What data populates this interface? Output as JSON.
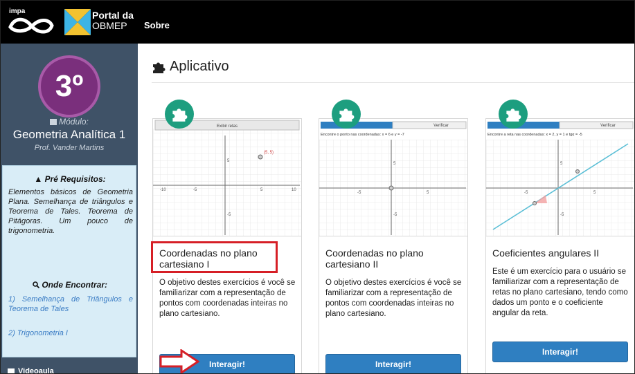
{
  "header": {
    "impa_label": "impa",
    "portal_line1": "Portal da",
    "portal_line2": "OBMEP",
    "nav_sobre": "Sobre"
  },
  "sidebar": {
    "module_number": "3º",
    "modulo_label": "Módulo:",
    "modulo_title": "Geometria Analítica 1",
    "professor": "Prof. Vander Martins",
    "prereq_title": "Pré Requisitos:",
    "prereq_text": "Elementos básicos de Geometria Plana. Semelhança de triângulos e Teorema de Tales. Teorema de Pitágoras. Um pouco de trigonometria.",
    "where_title": "Onde Encontrar:",
    "where_links": [
      "1) Semelhança de Triângulos e Teorema de Tales",
      "2) Trigonometria I"
    ],
    "video_label": "Videoaula"
  },
  "main": {
    "heading": "Aplicativo",
    "cards": [
      {
        "thumb_button": "Exibir retas",
        "point_label": "(5, 5)",
        "axis_labels": [
          "-10",
          "-5",
          "5",
          "10",
          "5",
          "-5"
        ],
        "title": "Coordenadas no plano cartesiano I",
        "description": "O objetivo destes exercícios é você se familiarizar com a representação de pontos com coordenadas inteiras no plano cartesiano.",
        "button": "Interagir!"
      },
      {
        "thumb_tab_right": "Verificar",
        "thumb_prompt": "Encontre o ponto nas coordenadas: x = 6 e y = -7",
        "axis_labels": [
          "-5",
          "5",
          "5",
          "-5"
        ],
        "title": "Coordenadas no plano cartesiano II",
        "description": "O objetivo destes exercícios é você se familiarizar com a representação de pontos com coordenadas inteiras no plano cartesiano.",
        "button": "Interagir!"
      },
      {
        "thumb_tab_right": "Verificar",
        "thumb_prompt": "Encontre a reta nas coordenadas: x = 2, y = 1 e tgα = -5",
        "axis_labels": [
          "-5",
          "5",
          "5",
          "-5"
        ],
        "title": "Coeficientes angulares II",
        "description": "Este é um exercício para o usuário se familiarizar com a representação de retas no plano cartesiano, tendo como dados um ponto e o coeficiente angular da reta.",
        "button": "Interagir!"
      }
    ]
  },
  "colors": {
    "topbar": "#000000",
    "sidebar": "#3f5267",
    "module_circle": "#7a2f7c",
    "badge": "#1d9e7f",
    "button": "#2f7fc1",
    "highlight": "#d61f26"
  },
  "icons": [
    "puzzle-icon",
    "book-icon",
    "warning-icon",
    "search-icon",
    "video-icon",
    "arrow-right-icon"
  ]
}
